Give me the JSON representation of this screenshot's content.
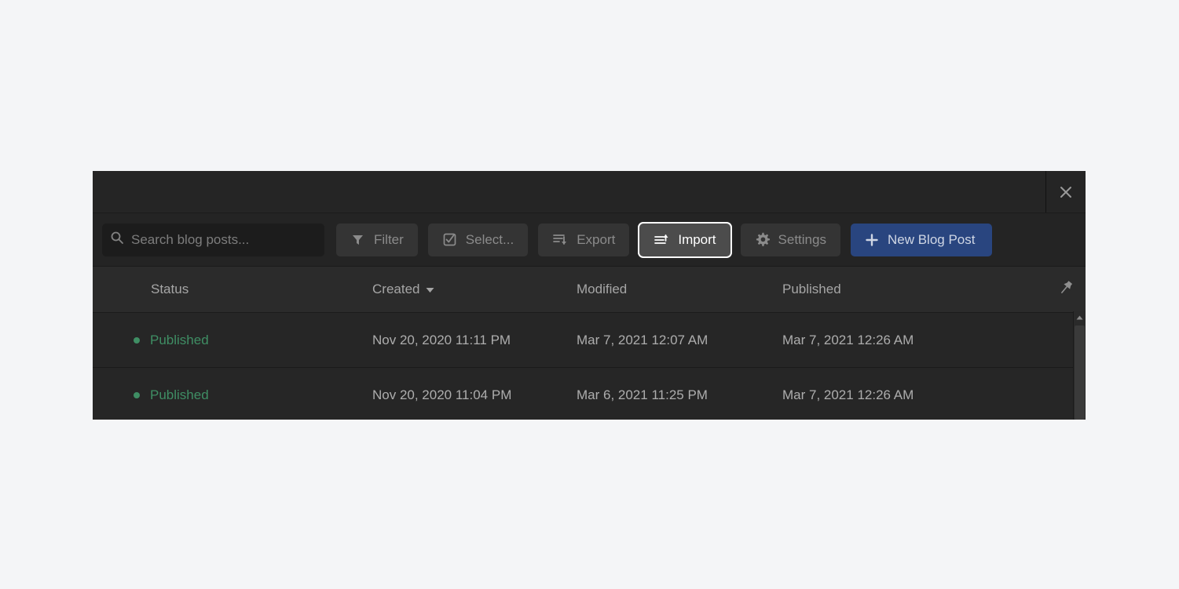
{
  "window": {
    "title": "",
    "close_icon": "close-icon"
  },
  "toolbar": {
    "search": {
      "placeholder": "Search blog posts...",
      "value": "",
      "icon": "search-icon"
    },
    "buttons": [
      {
        "label": "Filter",
        "icon": "filter-funnel-icon",
        "state": "normal"
      },
      {
        "label": "Select...",
        "icon": "checkbox-check-icon",
        "state": "normal"
      },
      {
        "label": "Export",
        "icon": "export-down-icon",
        "state": "normal"
      },
      {
        "label": "Import",
        "icon": "import-up-icon",
        "state": "focused"
      },
      {
        "label": "Settings",
        "icon": "gear-icon",
        "state": "normal"
      },
      {
        "label": "New Blog Post",
        "icon": "plus-icon",
        "state": "primary"
      }
    ]
  },
  "table": {
    "columns": [
      {
        "label": "Status",
        "sorted": false,
        "sort_dir": ""
      },
      {
        "label": "Created",
        "sorted": true,
        "sort_dir": "desc"
      },
      {
        "label": "Modified",
        "sorted": false,
        "sort_dir": ""
      },
      {
        "label": "Published",
        "sorted": false,
        "sort_dir": ""
      }
    ],
    "pin_icon": "pin-icon",
    "rows": [
      {
        "status": "Published",
        "created": "Nov 20, 2020 11:11 PM",
        "modified": "Mar 7, 2021 12:07 AM",
        "published": "Mar 7, 2021 12:26 AM"
      },
      {
        "status": "Published",
        "created": "Nov 20, 2020 11:04 PM",
        "modified": "Mar 6, 2021 11:25 PM",
        "published": "Mar 7, 2021 12:26 AM"
      }
    ]
  },
  "colors": {
    "page_background": "#f4f5f7",
    "panel_background": "#262626",
    "titlebar": "#252525",
    "toolbar": "#242424",
    "header_row": "#2b2b2b",
    "button": "#343434",
    "button_focused": "#4c4c4c",
    "primary_button": "#29457f",
    "status_published": "#3f8e64",
    "text_muted": "#8b8b8b",
    "text_body": "#adadad"
  },
  "scrollbar": {
    "up_arrow_icon": "triangle-up-icon",
    "visible": true
  }
}
